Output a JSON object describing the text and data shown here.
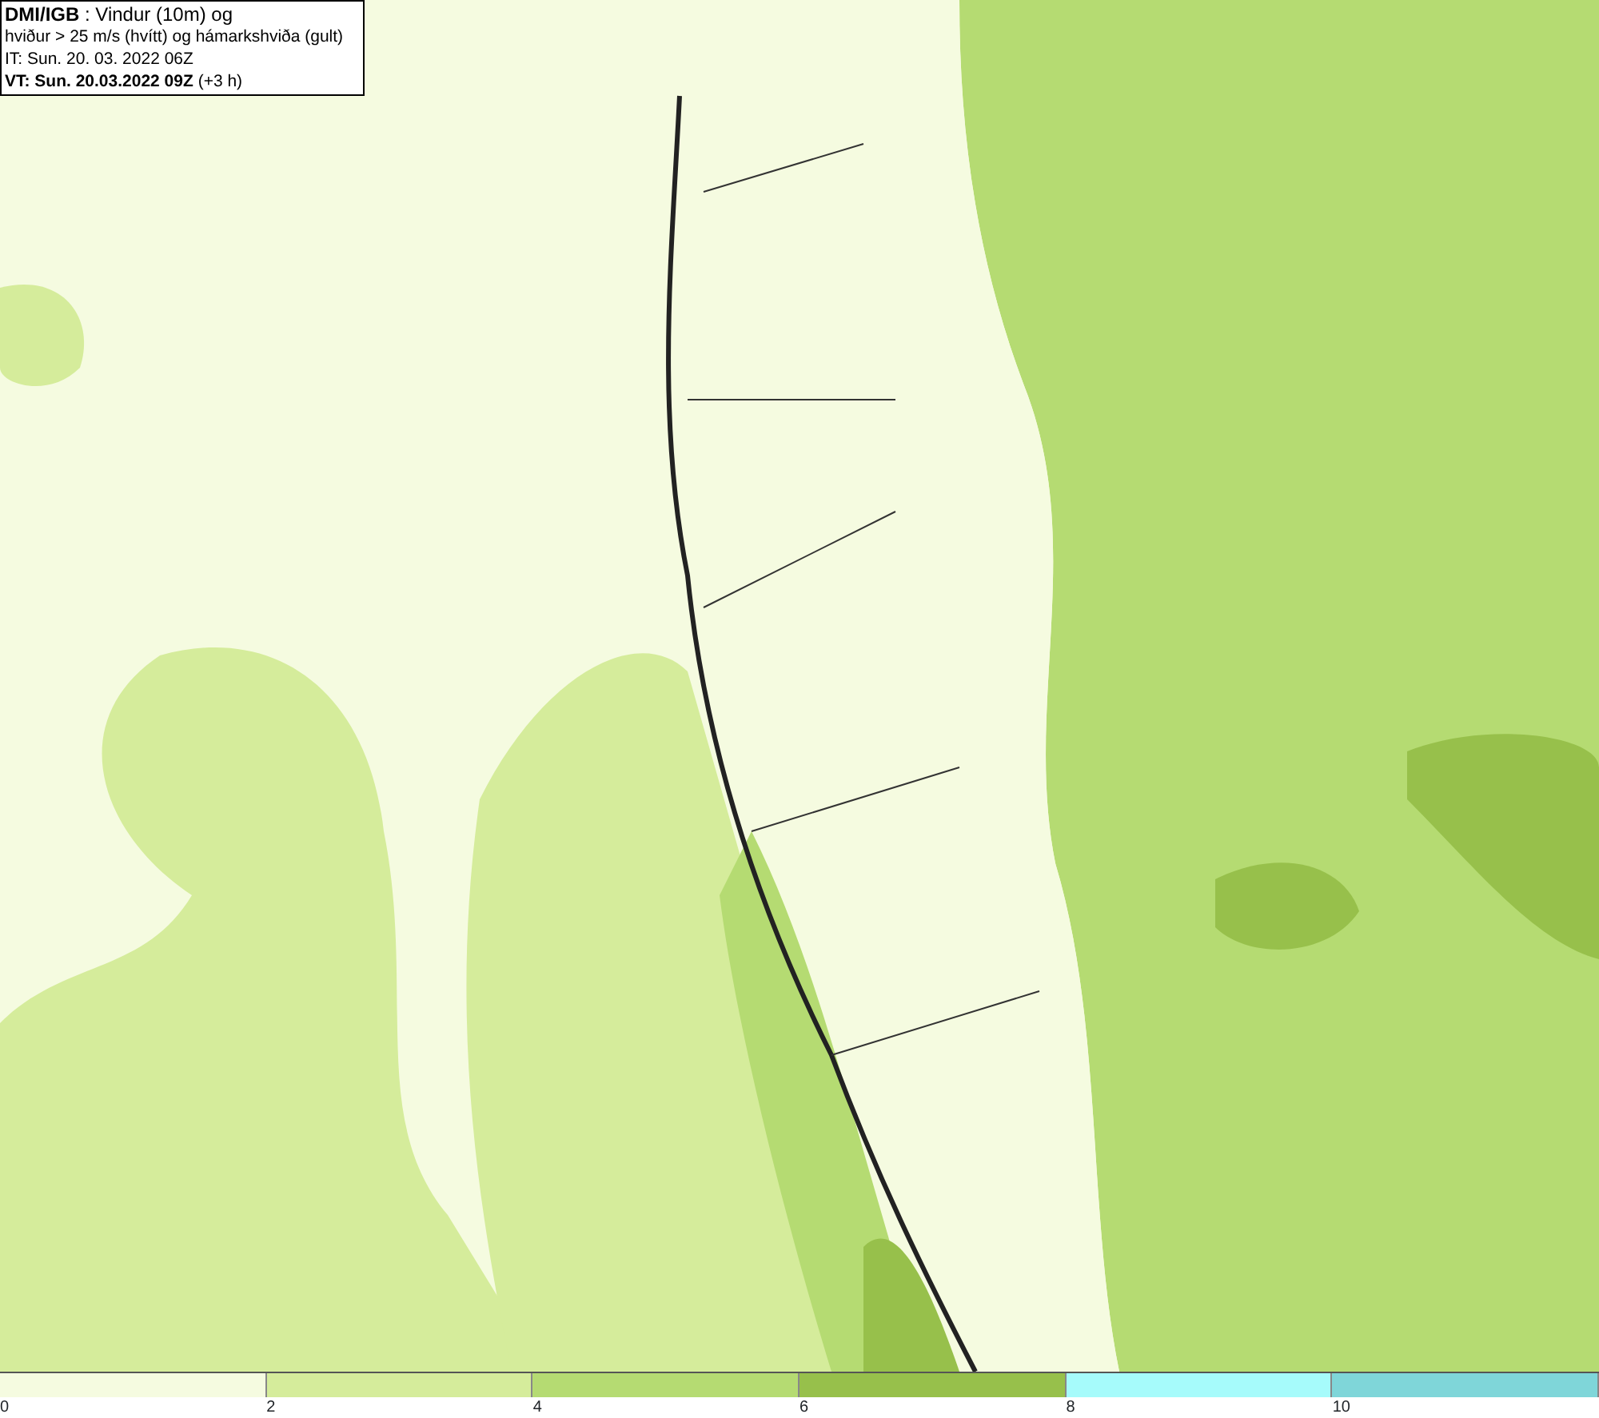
{
  "title_box": {
    "lines": [
      "**DMI/IGB** : Vindur (10m) og",
      "hviður > 25 m/s (hvítt) og hámarkshviða (gult)",
      "IT: Sun. 20. 03. 2022 06Z",
      "**VT: Sun. 20.03.2022 09Z** (+3 h)"
    ]
  },
  "legend": {
    "bands": [
      {
        "label": "0",
        "color": "#f5fbe0"
      },
      {
        "label": "2",
        "color": "#d5ec9b"
      },
      {
        "label": "4",
        "color": "#b5db72"
      },
      {
        "label": "6",
        "color": "#97c04b"
      },
      {
        "label": "8",
        "color": "#a6fbfb"
      },
      {
        "label": "10",
        "color": "#7fd6d9"
      }
    ]
  }
}
